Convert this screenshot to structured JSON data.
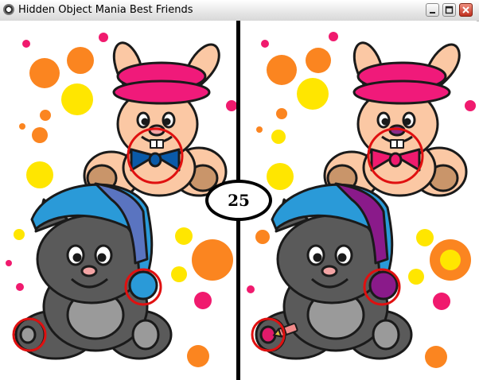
{
  "window": {
    "title": "Hidden Object Mania Best Friends",
    "controls": [
      "minimize-icon",
      "maximize-icon",
      "close-icon"
    ]
  },
  "game": {
    "differences_remaining": "25",
    "found_marker_color": "#e01010",
    "left_scene": {
      "bunny_bowtie_color": "#0a5aa8",
      "cat_hat_pompom_color": "#2a9ad8",
      "cat_footpad_color": "#9a9a9a"
    },
    "right_scene": {
      "bunny_bowtie_color": "#f01a6e",
      "bunny_nose_color": "#8a2a8a",
      "cat_hat_pompom_color": "#8a1a8a",
      "cat_footpad_color": "#e01a6a",
      "extra_item": "crayon-icon"
    }
  }
}
